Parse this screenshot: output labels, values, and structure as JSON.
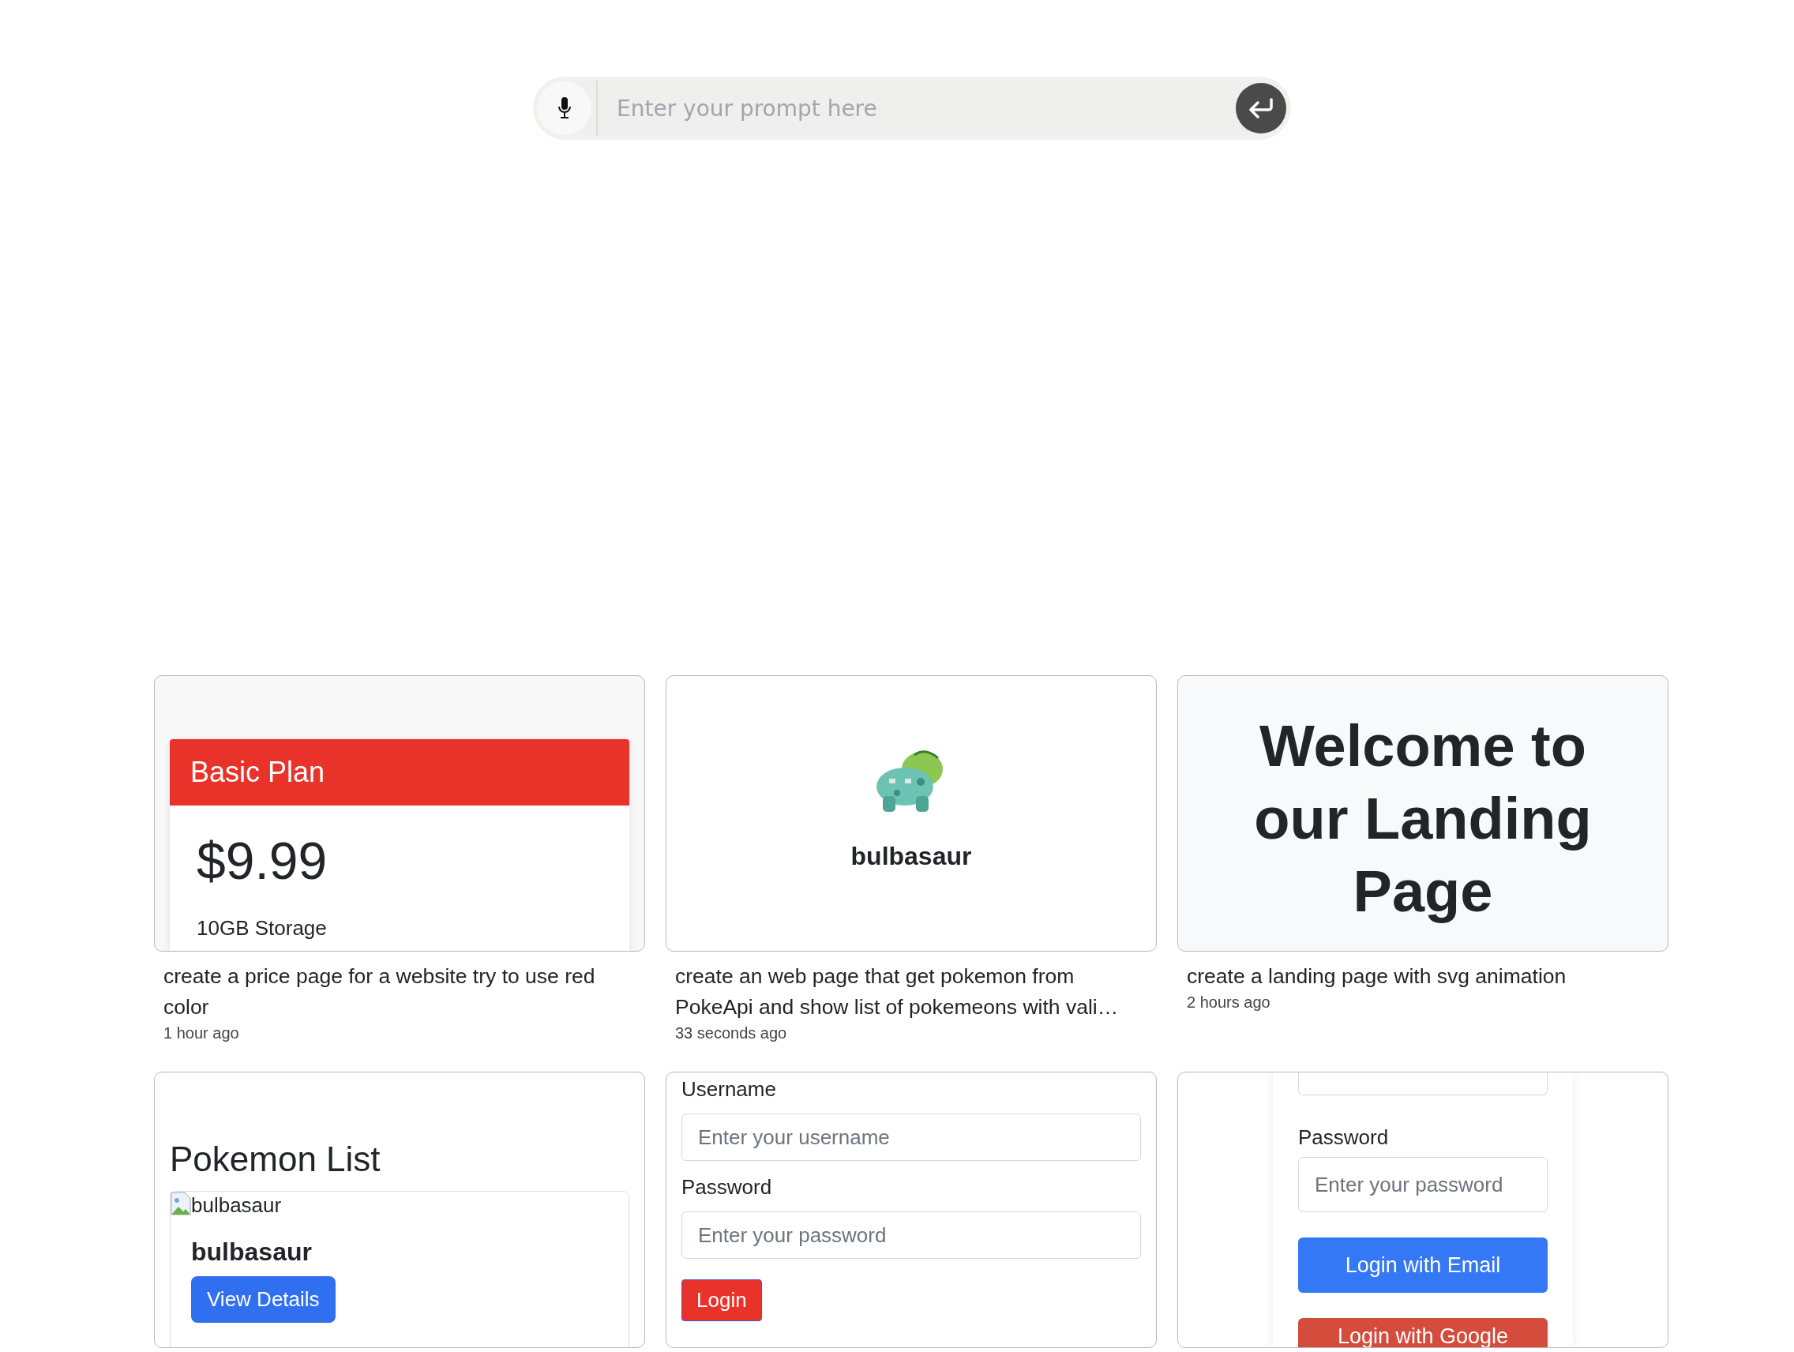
{
  "prompt_bar": {
    "placeholder": "Enter your prompt here"
  },
  "projects": [
    {
      "kind": "pricing",
      "preview": {
        "plan": "Basic Plan",
        "price": "$9.99",
        "feature": "10GB Storage"
      },
      "prompt": "create a price page for a website try to use red color",
      "time": "1 hour ago"
    },
    {
      "kind": "pokemon",
      "preview": {
        "name": "bulbasaur"
      },
      "prompt": "create an web page that get pokemon from PokeApi and show list of pokemeons with vali…",
      "time": "33 seconds ago"
    },
    {
      "kind": "landing",
      "preview": {
        "heading": "Welcome to our Landing Page"
      },
      "prompt": "create a landing page with svg animation",
      "time": "2 hours ago"
    },
    {
      "kind": "pokemon_list",
      "preview": {
        "title": "Pokemon List",
        "image_alt": "bulbasaur",
        "name": "bulbasaur",
        "button": "View Details"
      }
    },
    {
      "kind": "login",
      "preview": {
        "fields": [
          {
            "label": "Username",
            "placeholder": "Enter your username"
          },
          {
            "label": "Password",
            "placeholder": "Enter your password"
          }
        ],
        "button": "Login"
      }
    },
    {
      "kind": "login_social",
      "preview": {
        "fields": [
          {
            "label": "Password",
            "placeholder": "Enter your password"
          }
        ],
        "buttons": [
          "Login with Email",
          "Login with Google"
        ]
      }
    }
  ]
}
